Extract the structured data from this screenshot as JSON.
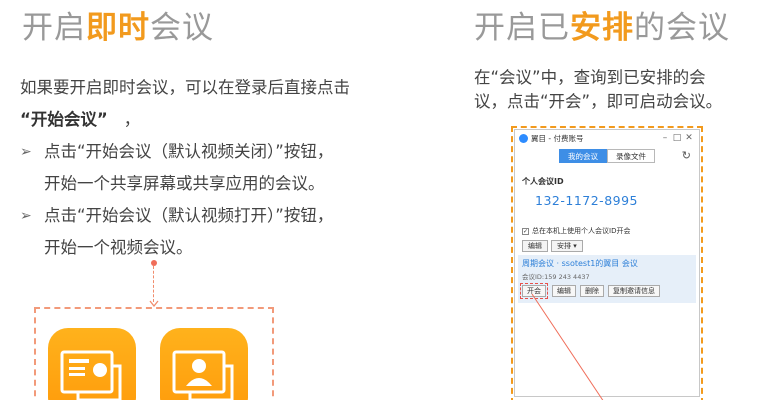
{
  "left": {
    "title_normal": "开启",
    "title_highlight": "即时",
    "title_end": "会议",
    "intro_line1": "如果要开启即时会议，可以在登录后直接点击",
    "intro_quote": "“开始会议”",
    "intro_comma": "，",
    "bullet1_line1": "点击“开始会议（默认视频关闭）”按钮，",
    "bullet1_line2": "开始一个共享屏幕或共享应用的会议。",
    "bullet2_line1": "点击“开始会议（默认视频打开）”按钮，",
    "bullet2_line2": "开始一个视频会议。",
    "bullet_symbol": "➢"
  },
  "right": {
    "title_normal": "开启已",
    "title_highlight": "安排",
    "title_end": "的会议",
    "desc_line1": "在“会议”中，查询到已安排的会",
    "desc_line2": "议，点击“开会”，即可启动会议。"
  },
  "window": {
    "title": "翼目 - 付费账号",
    "tab_my_meetings": "我的会议",
    "tab_recordings": "录像文件",
    "personal_meeting_label": "个人会议ID",
    "personal_meeting_number": "132-1172-8995",
    "checkbox_label": "总在本机上使用个人会议ID开会",
    "edit_label": "编辑",
    "schedule_label": "安排 ▾",
    "meeting_title": "周期会议 · ssotest1的翼目 会议",
    "meeting_id": "会议ID:159 243 4437",
    "start_label": "开会",
    "meeting_edit_label": "编辑",
    "delete_label": "删除",
    "copy_invite_label": "复制邀请信息"
  },
  "colors": {
    "accent_orange": "#f29a1d",
    "title_gray": "#999999",
    "link_blue": "#2d7fd8",
    "dash_red": "#f08c6c"
  }
}
